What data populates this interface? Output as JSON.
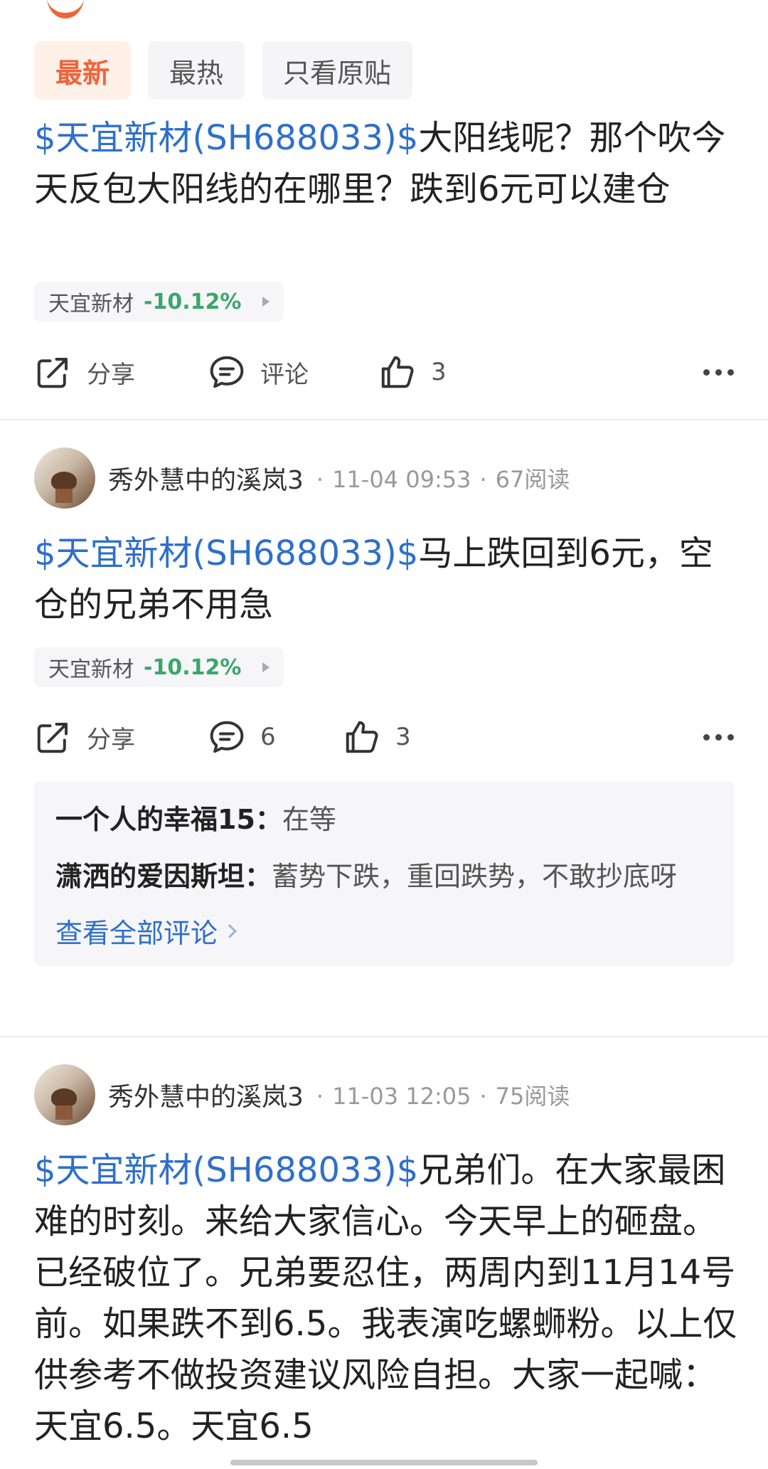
{
  "filters": {
    "latest": "最新",
    "hot": "最热",
    "original_only": "只看原贴"
  },
  "posts": [
    {
      "stock_link": "$天宜新材(SH688033)$",
      "body": "大阳线呢？那个吹今天反包大阳线的在哪里？跌到6元可以建仓",
      "chip": {
        "name": "天宜新材",
        "change": "-10.12%"
      },
      "actions": {
        "share": "分享",
        "comment": "评论",
        "likes": "3"
      }
    },
    {
      "author": "秀外慧中的溪岚3",
      "time": "11-04 09:53",
      "reads": "67阅读",
      "stock_link": "$天宜新材(SH688033)$",
      "body": "马上跌回到6元，空仓的兄弟不用急",
      "chip": {
        "name": "天宜新材",
        "change": "-10.12%"
      },
      "actions": {
        "share": "分享",
        "comment": "6",
        "likes": "3"
      },
      "comments": [
        {
          "author": "一个人的幸福15：",
          "text": "在等"
        },
        {
          "author": "潇洒的爱因斯坦：",
          "text": "蓄势下跌，重回跌势，不敢抄底呀"
        }
      ],
      "view_all": "查看全部评论"
    },
    {
      "author": "秀外慧中的溪岚3",
      "time": "11-03 12:05",
      "reads": "75阅读",
      "stock_link": "$天宜新材(SH688033)$",
      "body": "兄弟们。在大家最困难的时刻。来给大家信心。今天早上的砸盘。已经破位了。兄弟要忍住，两周内到11月14号前。如果跌不到6.5。我表演吃螺蛳粉。以上仅供参考不做投资建议风险自担。大家一起喊：天宜6.5。天宜6.5"
    }
  ],
  "colors": {
    "accent": "#f0643a",
    "link": "#2f6fcb",
    "down": "#3aa76a"
  }
}
